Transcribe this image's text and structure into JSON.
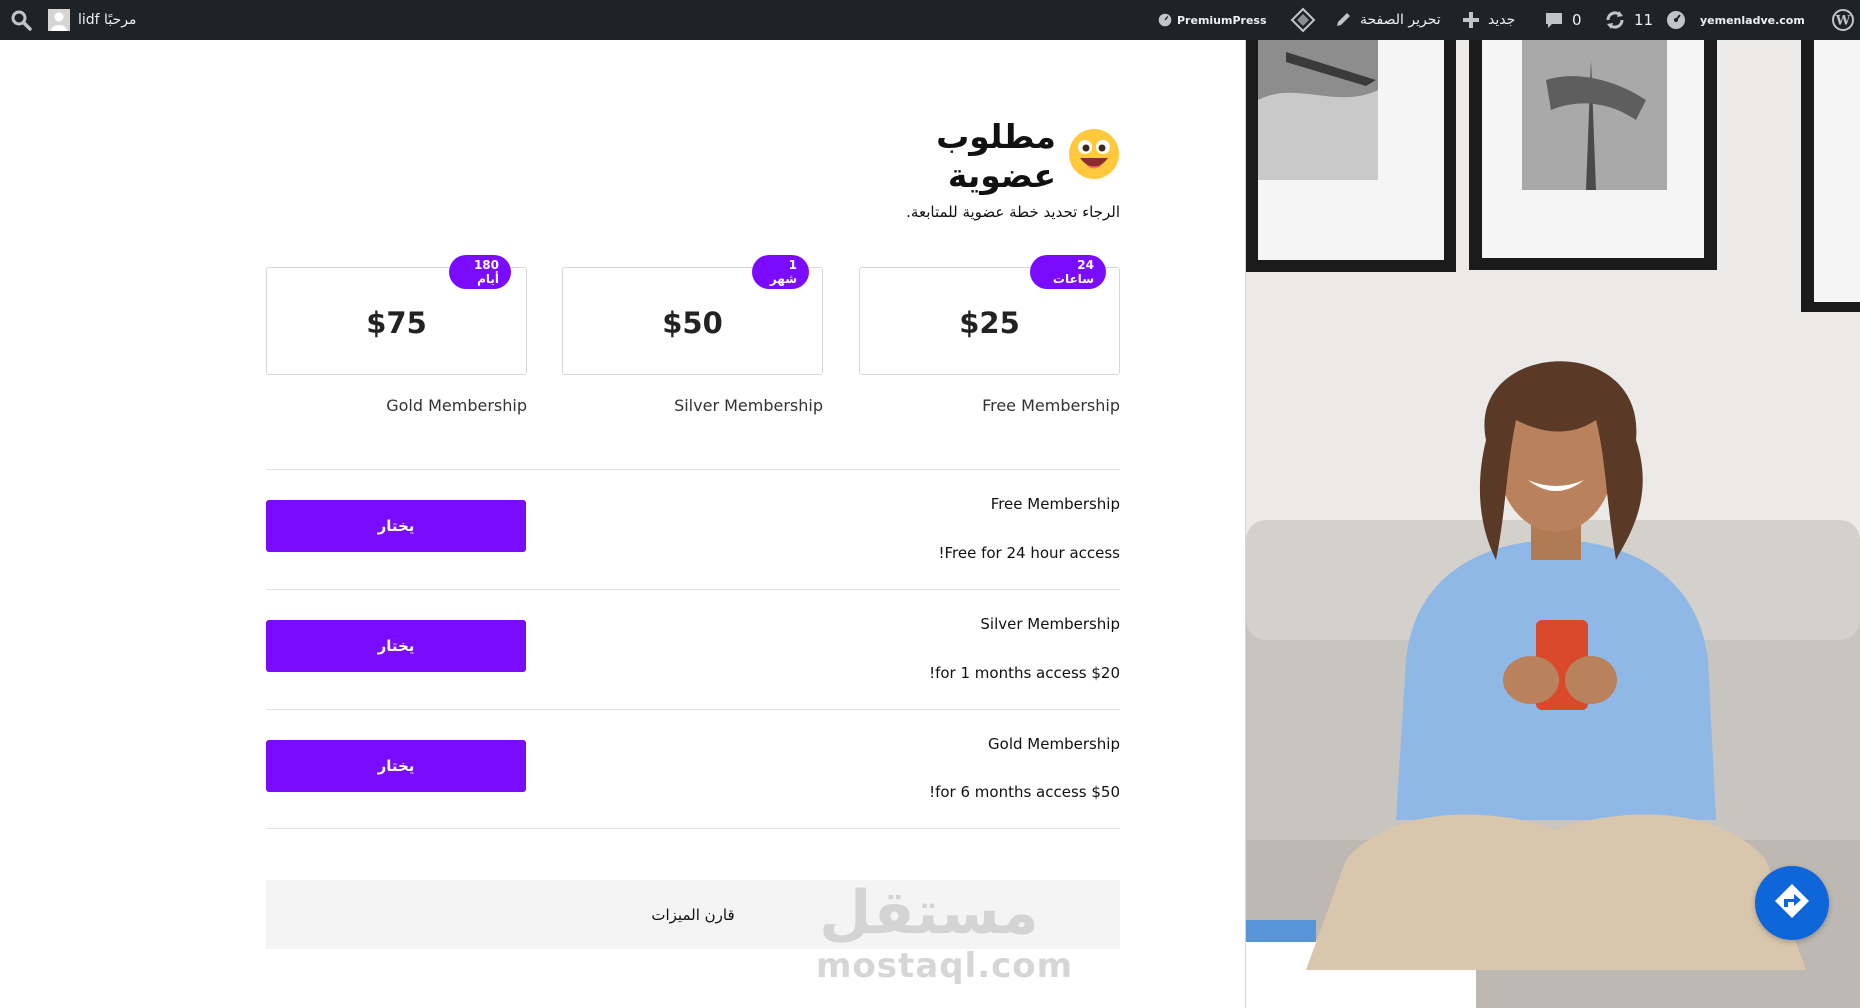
{
  "admin_bar": {
    "site_name": "yemenladve.com",
    "updates_count": "11",
    "comments_count": "0",
    "new_label": "جديد",
    "edit_page_label": "تحرير الصفحة",
    "premiumpress_label": "PremiumPress",
    "greeting": "مرحبًا lidf"
  },
  "page": {
    "title": "مطلوب عضوية",
    "subtitle": "الرجاء تحديد خطة عضوية للمتابعة."
  },
  "plans": [
    {
      "price": "$25",
      "duration": "24 ساعات",
      "name": "Free Membership"
    },
    {
      "price": "$50",
      "duration": "1 شهر",
      "name": "Silver Membership"
    },
    {
      "price": "$75",
      "duration": "180 أيام",
      "name": "Gold Membership"
    }
  ],
  "rows": [
    {
      "title": "Free Membership",
      "description": "!Free for 24 hour access",
      "button": "يختار"
    },
    {
      "title": "Silver Membership",
      "description": "!for 1 months access $20",
      "button": "يختار"
    },
    {
      "title": "Gold Membership",
      "description": "!for 6 months access $50",
      "button": "يختار"
    }
  ],
  "compare_label": "قارن الميزات",
  "watermark": {
    "arabic": "مستقل",
    "latin": "mostaql.com"
  },
  "colors": {
    "accent": "#7a0bff",
    "admin_bar": "#1d2327",
    "fab": "#0f66d9"
  },
  "icons": [
    "wordpress-icon",
    "dashboard-icon",
    "refresh-icon",
    "comment-icon",
    "plus-icon",
    "pencil-icon",
    "diamond-icon",
    "search-icon",
    "avatar",
    "emoji-icon",
    "direction-icon"
  ]
}
